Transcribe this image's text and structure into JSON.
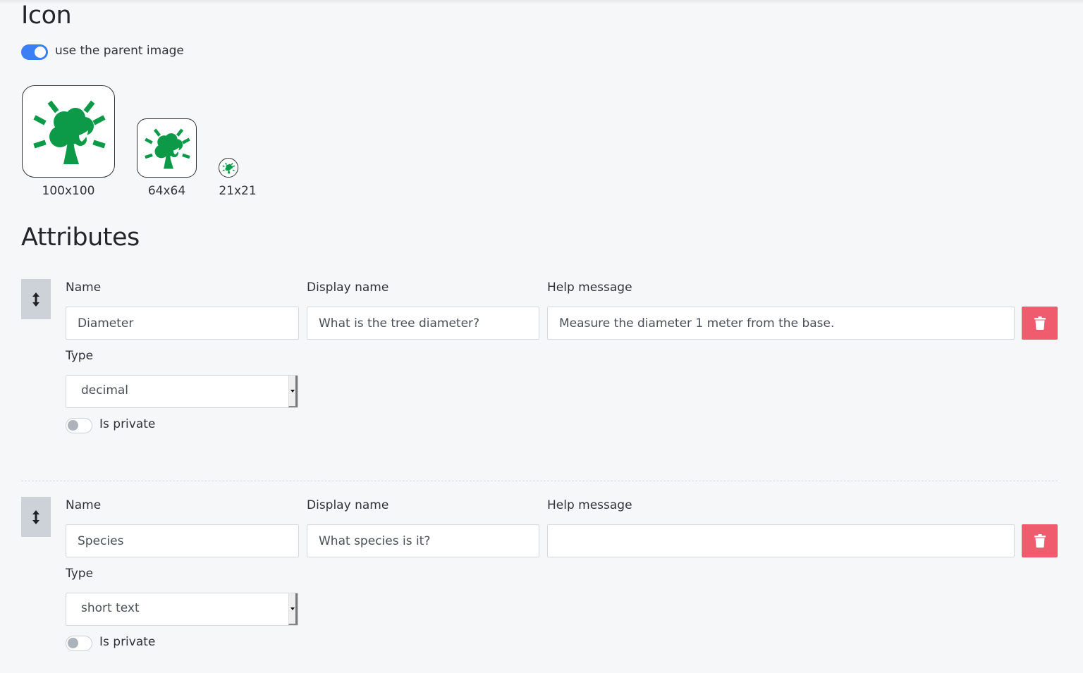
{
  "icon_section": {
    "title": "Icon",
    "use_parent_toggle": {
      "label": "use the parent image",
      "checked": true
    },
    "icon_color": "#0c9a48",
    "previews": [
      {
        "size_label": "100x100",
        "icon": "tree-sun-icon"
      },
      {
        "size_label": "64x64",
        "icon": "tree-sun-icon"
      },
      {
        "size_label": "21x21",
        "icon": "tree-sun-icon"
      }
    ]
  },
  "attributes_section": {
    "title": "Attributes",
    "labels": {
      "name": "Name",
      "display_name": "Display name",
      "help_message": "Help message",
      "type": "Type",
      "is_private": "Is private"
    },
    "delete_color": "#ee5c6d",
    "toggle_on_color": "#3b7ff6",
    "items": [
      {
        "name": "Diameter",
        "display_name": "What is the tree diameter?",
        "help_message": "Measure the diameter 1 meter from the base.",
        "type": "decimal",
        "is_private": false
      },
      {
        "name": "Species",
        "display_name": "What species is it?",
        "help_message": "",
        "type": "short text",
        "is_private": false
      }
    ]
  }
}
